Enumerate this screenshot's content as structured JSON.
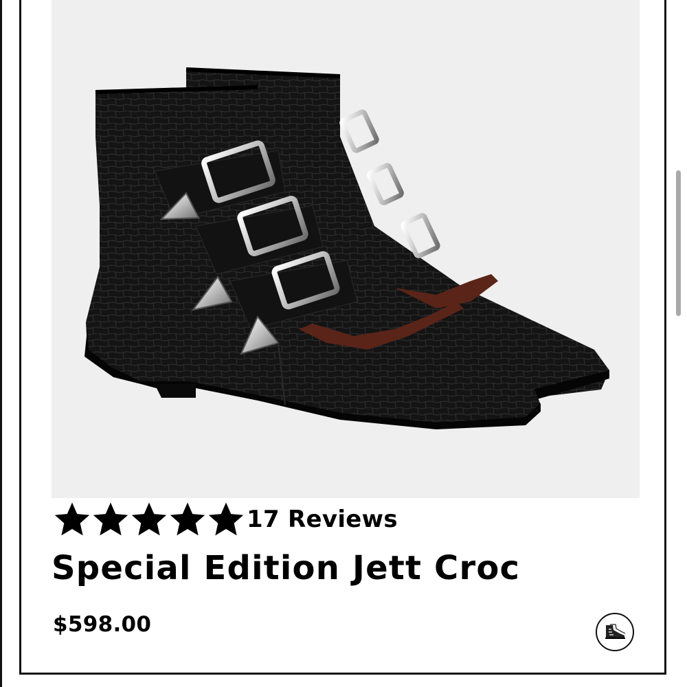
{
  "product": {
    "title": "Special Edition Jett Croc",
    "price": "$598.00",
    "rating_stars": 5,
    "reviews_label": "17 Reviews",
    "image_subject": "boots-photo"
  },
  "colors": {
    "background": "#ffffff",
    "image_background": "#efefef",
    "text": "#000000",
    "border": "#111111"
  }
}
